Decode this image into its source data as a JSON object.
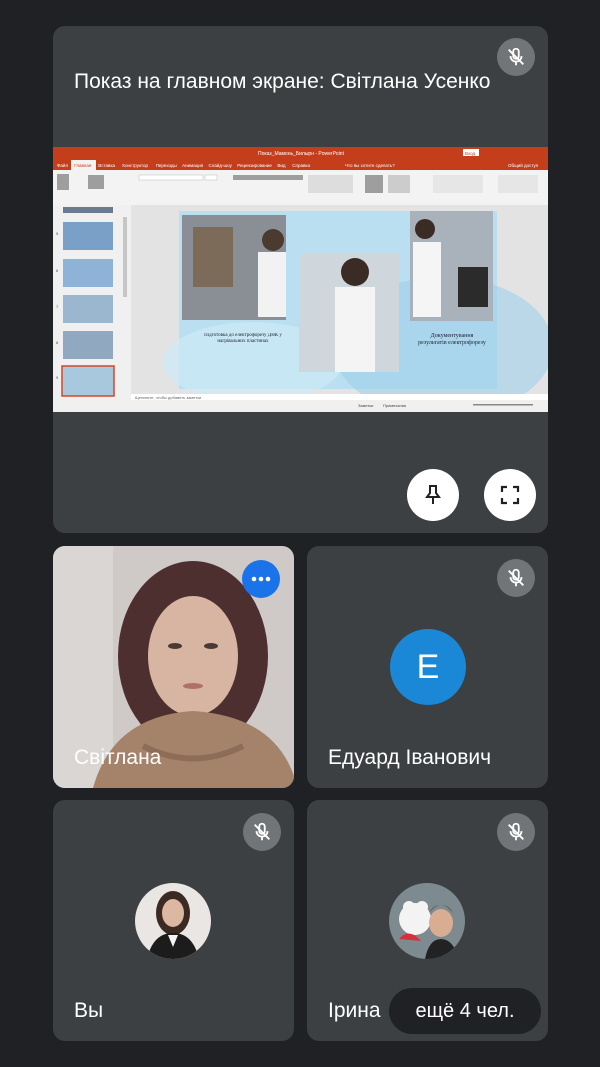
{
  "presenter": {
    "title": "Показ на главном экране: Світлана Усенко",
    "window_title": "Показ_Мамонь_Билырн - PowerPoint",
    "ribbon_tabs": [
      "Файл",
      "Главная",
      "Вставка",
      "Конструктор",
      "Переходы",
      "Анимация",
      "Слайд-шоу",
      "Рецензирование",
      "Вид",
      "Справка"
    ],
    "search_hint": "Что вы хотите сделать?",
    "share_label": "Общий доступ",
    "signin_label": "Вход",
    "slide_text_left": "Підготовка до електрофорезу ДНК у нагрівальних пластинах",
    "slide_text_right": "Документування результатів електрофорезу",
    "notes_placeholder": "Щелкните, чтобы добавить заметки",
    "status_notes": "Заметки",
    "status_comments": "Примечания",
    "slide_numbers": [
      "5",
      "6",
      "7",
      "8",
      "9"
    ]
  },
  "participants": [
    {
      "name": "Світлана",
      "initial": ""
    },
    {
      "name": "Едуард Іванович",
      "initial": "E"
    },
    {
      "name": "Ви",
      "initial": ""
    },
    {
      "name": "Ірина",
      "initial": ""
    }
  ],
  "participants_display": {
    "self_label": "Вы"
  },
  "more_label": "ещё 4 чел.",
  "colors": {
    "background": "#202124",
    "tile": "#3c4043",
    "accent_blue": "#1a88d6",
    "powerpoint_orange": "#c43e1c"
  },
  "icons": {
    "mic_off": "mic-off-icon",
    "pin": "pin-icon",
    "fullscreen": "fullscreen-icon",
    "more": "more-options-icon"
  }
}
